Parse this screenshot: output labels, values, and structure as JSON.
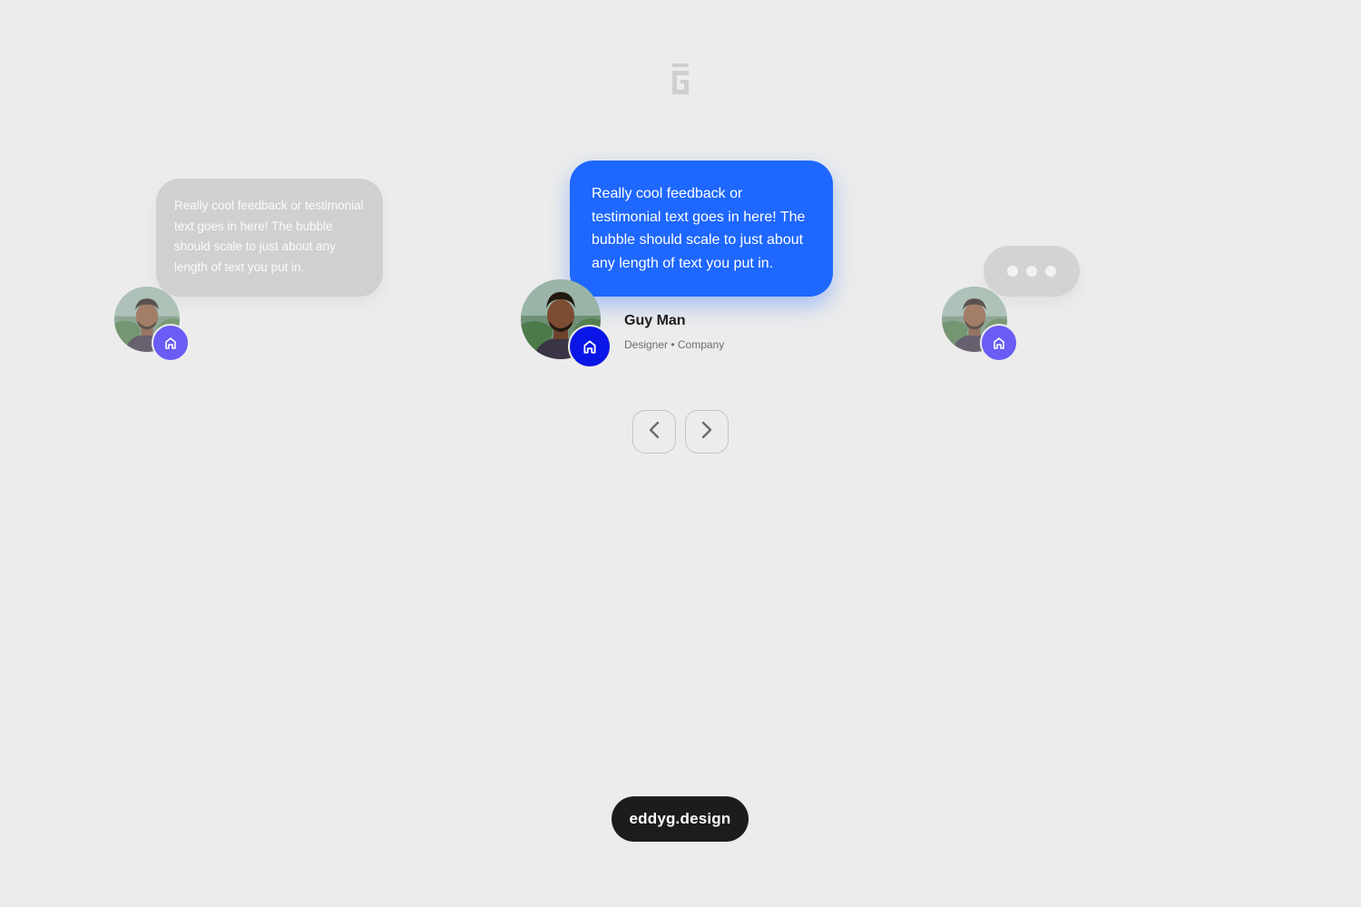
{
  "brand": {
    "logo_icon": "g-logo-icon"
  },
  "testimonials": [
    {
      "id": "left",
      "text": "Really cool feedback or testimonial text goes in here! The bubble should scale to just about any length of text you put in.",
      "avatar_icon": "portrait-avatar",
      "badge_icon": "home-icon",
      "badge_color": "#6a5cf4"
    },
    {
      "id": "center",
      "text": "Really cool feedback or testimonial text goes in here! The bubble should scale to just about any length of text you put in.",
      "name": "Guy Man",
      "role": "Designer • Company",
      "avatar_icon": "portrait-avatar",
      "badge_icon": "home-icon",
      "badge_color": "#0a16e6",
      "bubble_color": "#1e67ff"
    },
    {
      "id": "right",
      "typing_indicator": true,
      "avatar_icon": "portrait-avatar",
      "badge_icon": "home-icon",
      "badge_color": "#6a5cf4"
    }
  ],
  "navigation": {
    "prev_icon": "chevron-left-icon",
    "next_icon": "chevron-right-icon"
  },
  "footer": {
    "label": "eddyg.design"
  }
}
